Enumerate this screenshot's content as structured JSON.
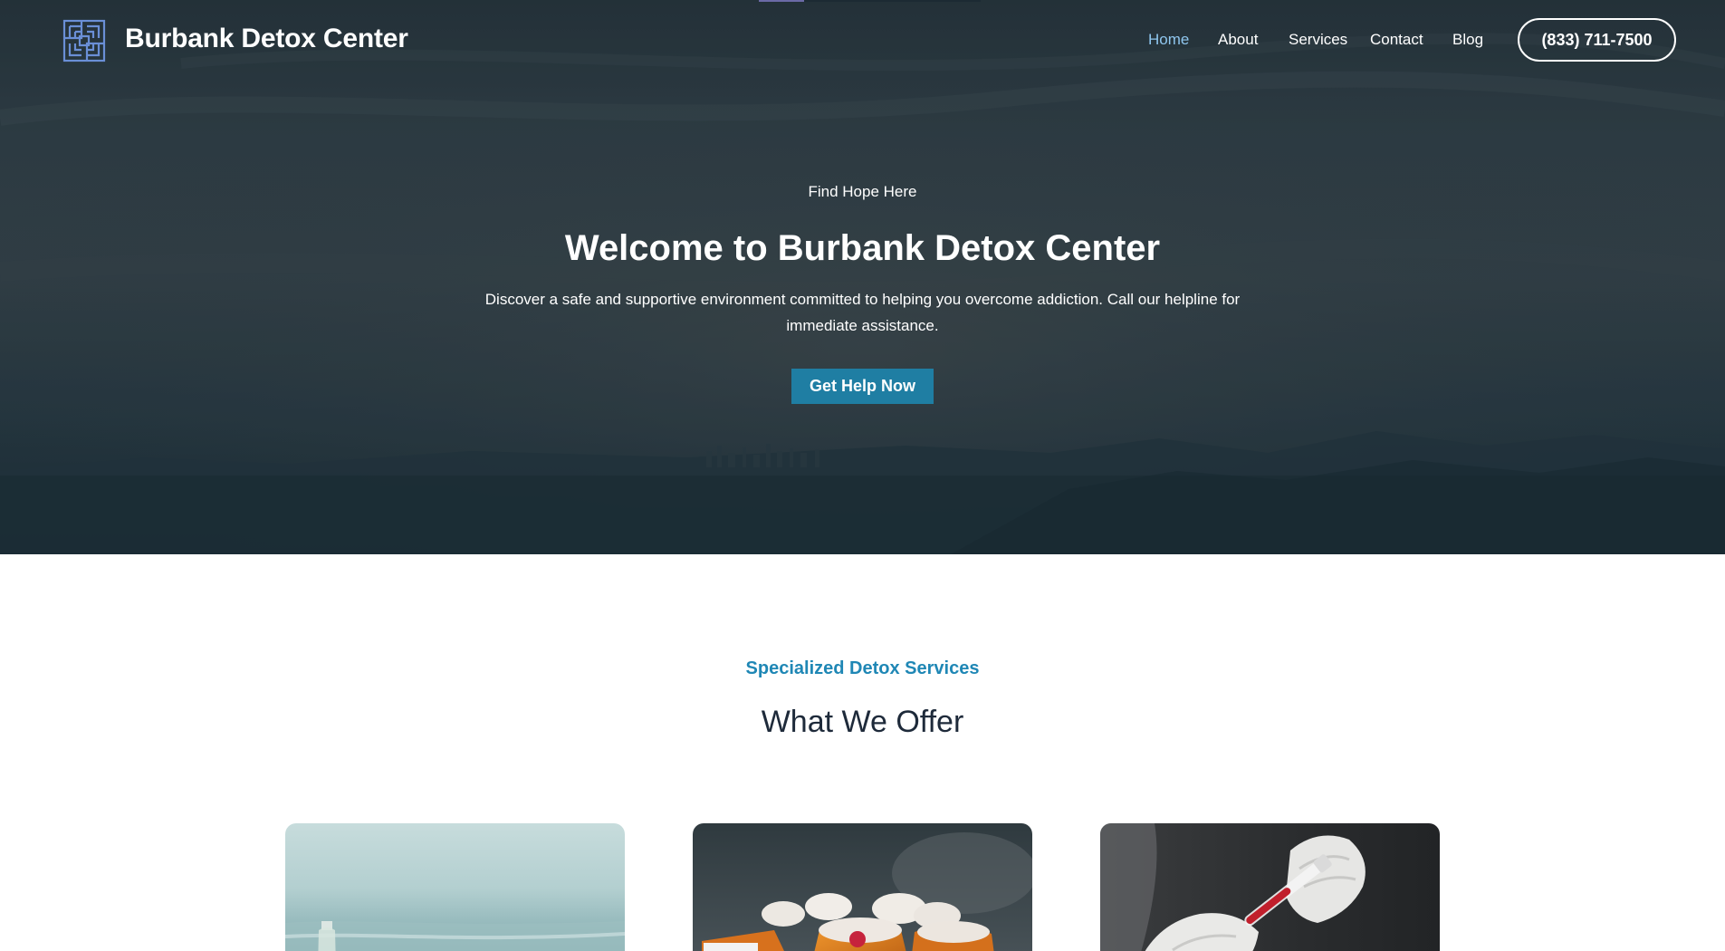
{
  "header": {
    "site_title": "Burbank Detox Center",
    "nav": [
      {
        "label": "Home",
        "active": true
      },
      {
        "label": "About",
        "active": false
      },
      {
        "label": "Services",
        "active": false
      },
      {
        "label": "Contact",
        "active": false
      },
      {
        "label": "Blog",
        "active": false
      }
    ],
    "phone_label": "(833) 711-7500",
    "logo_icon": "maze-logo-icon"
  },
  "hero": {
    "eyebrow": "Find Hope Here",
    "title": "Welcome to Burbank Detox Center",
    "text": "Discover a safe and supportive environment committed to helping you overcome addiction. Call our helpline for immediate assistance.",
    "cta_label": "Get Help Now",
    "background_image": "dusky-sky-over-city-and-hills"
  },
  "offer": {
    "eyebrow": "Specialized Detox Services",
    "title": "What We Offer",
    "cards": [
      {
        "image": "seaside-glass-bottle"
      },
      {
        "image": "spilled-pill-bottles"
      },
      {
        "image": "gloved-hands-test-tube"
      }
    ]
  },
  "colors": {
    "accent": "#1f7ea3",
    "eyebrow_blue": "#1f87b5",
    "nav_active": "#8fc6ee",
    "heading_dark": "#1e2a3a"
  }
}
